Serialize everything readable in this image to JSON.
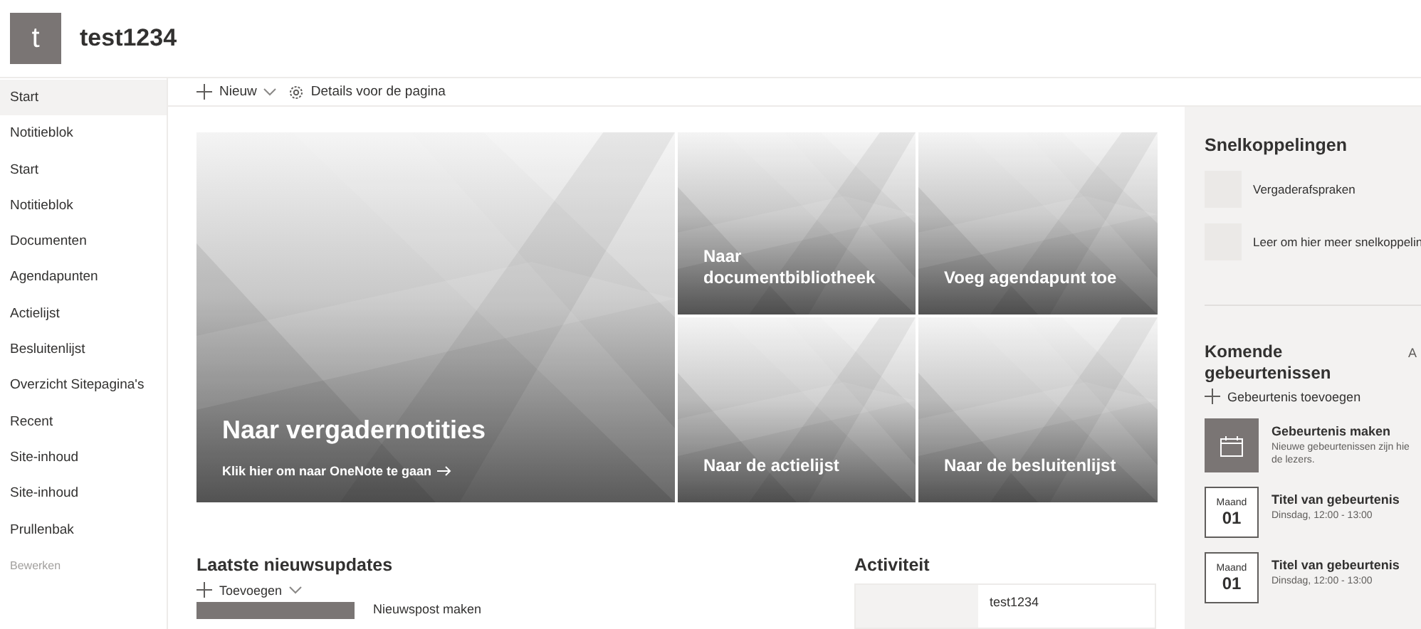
{
  "site": {
    "logo_letter": "t",
    "title": "test1234"
  },
  "nav": {
    "items": [
      {
        "label": "Start",
        "selected": true
      },
      {
        "label": "Notitieblok",
        "selected": false
      },
      {
        "label": "Start",
        "selected": false
      },
      {
        "label": "Notitieblok",
        "selected": false
      },
      {
        "label": "Documenten",
        "selected": false
      },
      {
        "label": "Agendapunten",
        "selected": false
      },
      {
        "label": "Actielijst",
        "selected": false
      },
      {
        "label": "Besluitenlijst",
        "selected": false
      },
      {
        "label": "Overzicht Sitepagina's",
        "selected": false
      },
      {
        "label": "Recent",
        "selected": false
      },
      {
        "label": "Site-inhoud",
        "selected": false
      },
      {
        "label": "Site-inhoud",
        "selected": false
      },
      {
        "label": "Prullenbak",
        "selected": false
      }
    ],
    "edit": "Bewerken"
  },
  "command_bar": {
    "new": "Nieuw",
    "details": "Details voor de pagina"
  },
  "hero": {
    "main": {
      "title": "Naar vergadernotities",
      "link": "Klik hier om naar OneNote te gaan"
    },
    "tiles": [
      {
        "title": "Naar documentbibliotheek"
      },
      {
        "title": "Voeg agendapunt toe"
      },
      {
        "title": "Naar de actielijst"
      },
      {
        "title": "Naar de besluitenlijst"
      }
    ]
  },
  "news": {
    "title": "Laatste nieuwsupdates",
    "add": "Toevoegen",
    "item": "Nieuwspost maken"
  },
  "activity": {
    "title": "Activiteit",
    "item": "test1234"
  },
  "quick_links": {
    "title": "Snelkoppelingen",
    "items": [
      "Vergaderafspraken",
      "Leer om hier meer snelkoppelin"
    ]
  },
  "events": {
    "title": "Komende gebeurtenissen",
    "see_all": "A",
    "add": "Gebeurtenis toevoegen",
    "create": {
      "title": "Gebeurtenis maken",
      "lines": [
        "Nieuwe gebeurtenissen zijn hie",
        "de lezers."
      ]
    },
    "items": [
      {
        "month": "Maand",
        "day": "01",
        "title": "Titel van gebeurtenis",
        "time": "Dinsdag, 12:00 - 13:00"
      },
      {
        "month": "Maand",
        "day": "01",
        "title": "Titel van gebeurtenis",
        "time": "Dinsdag, 12:00 - 13:00"
      }
    ]
  }
}
